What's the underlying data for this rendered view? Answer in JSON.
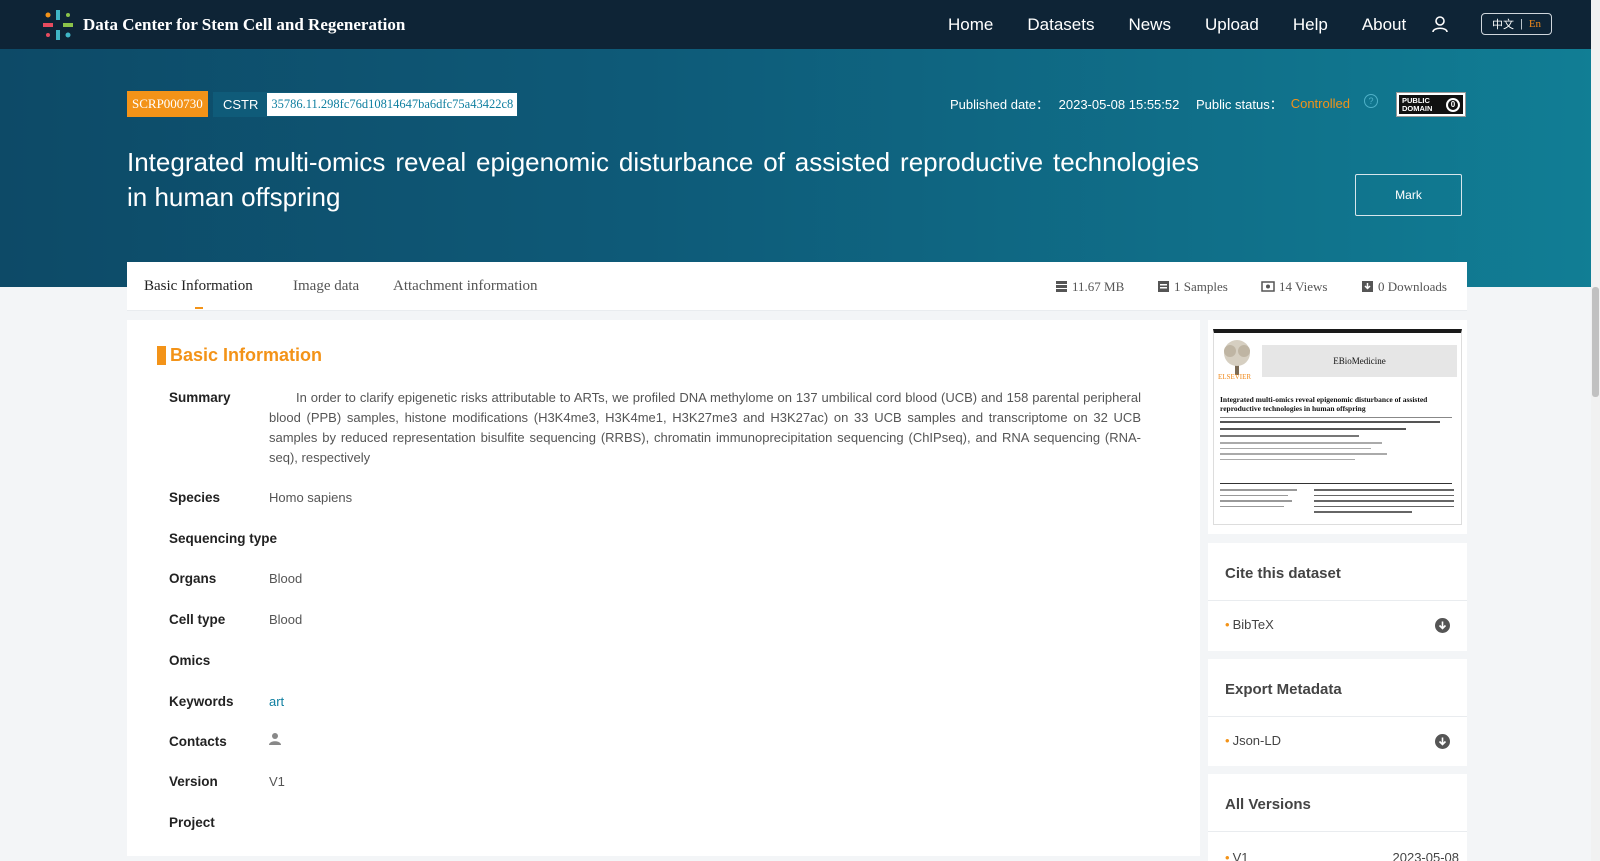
{
  "nav": {
    "brand": "Data Center for Stem Cell and Regeneration",
    "items": [
      "Home",
      "Datasets",
      "News",
      "Upload",
      "Help",
      "About"
    ],
    "lang_cn": "中文",
    "lang_en": "En"
  },
  "hero": {
    "id": "SCRP000730",
    "cstr_label": "CSTR",
    "cstr_value": "35786.11.298fc76d10814647ba6dfc75a43422c8",
    "published_label": "Published date：",
    "published_value": "2023-05-08 15:55:52",
    "status_label": "Public status：",
    "status_value": "Controlled",
    "help_glyph": "?",
    "license_line1": "PUBLIC",
    "license_line2": "DOMAIN",
    "title": "Integrated multi-omics reveal epigenomic disturbance of assisted reproductive technologies in human offspring",
    "mark_label": "Mark"
  },
  "tabs": [
    {
      "label": "Basic Information"
    },
    {
      "label": "Image data"
    },
    {
      "label": "Attachment information"
    }
  ],
  "stats": {
    "size": "11.67 MB",
    "samples": "1 Samples",
    "views": "14 Views",
    "downloads": "0 Downloads"
  },
  "basic": {
    "section_title": "Basic Information",
    "summary_label": "Summary",
    "summary": "In order to clarify epigenetic risks attributable to ARTs, we profiled DNA methylome on 137 umbilical cord blood (UCB) and 158 parental peripheral blood (PPB) samples, histone modifications (H3K4me3, H3K4me1, H3K27me3 and H3K27ac) on 33 UCB samples and transcriptome on 32 UCB samples by reduced representation bisulfite sequencing (RRBS), chromatin immunoprecipitation sequencing (ChIPseq), and RNA sequencing (RNA-seq), respectively",
    "species_label": "Species",
    "species": "Homo sapiens",
    "seqtype_label": "Sequencing type",
    "organs_label": "Organs",
    "organs": "Blood",
    "celltype_label": "Cell type",
    "celltype": "Blood",
    "omics_label": "Omics",
    "keywords_label": "Keywords",
    "keywords": "art",
    "contacts_label": "Contacts",
    "version_label": "Version",
    "version": "V1",
    "project_label": "Project"
  },
  "preview": {
    "journal": "EBioMedicine",
    "publisher": "ELSEVIER",
    "paper_title": "Integrated multi-omics reveal epigenomic disturbance of assisted reproductive technologies in human offspring"
  },
  "cite": {
    "title": "Cite this dataset",
    "item": "BibTeX"
  },
  "export": {
    "title": "Export Metadata",
    "item": "Json-LD"
  },
  "versions": {
    "title": "All Versions",
    "item": "V1",
    "date": "2023-05-08"
  },
  "colors": {
    "navbar": "#0e2436",
    "accent": "#f39318",
    "hero_start": "#0d4a67",
    "hero_end": "#117e95",
    "link": "#0f7fa0"
  }
}
